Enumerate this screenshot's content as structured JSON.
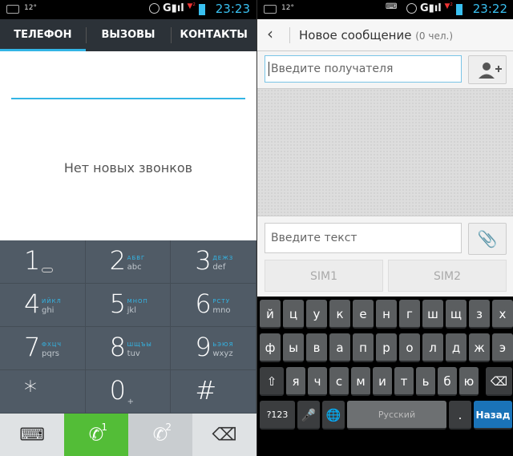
{
  "left": {
    "status": {
      "temp": "12°",
      "clock": "23:23"
    },
    "tabs": [
      "ТЕЛЕФОН",
      "ВЫЗОВЫ",
      "КОНТАКТЫ"
    ],
    "empty_text": "Нет новых звонков",
    "dialpad": [
      {
        "digit": "1",
        "letters": "",
        "latin": ""
      },
      {
        "digit": "2",
        "letters": "abc",
        "latin": "АБВГ"
      },
      {
        "digit": "3",
        "letters": "def",
        "latin": "ДЕЖЗ"
      },
      {
        "digit": "4",
        "letters": "ghi",
        "latin": "ИЙКЛ"
      },
      {
        "digit": "5",
        "letters": "jkl",
        "latin": "МНОП"
      },
      {
        "digit": "6",
        "letters": "mno",
        "latin": "РСТУ"
      },
      {
        "digit": "7",
        "letters": "pqrs",
        "latin": "ФХЦЧ"
      },
      {
        "digit": "8",
        "letters": "tuv",
        "latin": "ШЩЪЫ"
      },
      {
        "digit": "9",
        "letters": "wxyz",
        "latin": "ЬЭЮЯ"
      },
      {
        "digit": "*",
        "letters": "",
        "latin": ""
      },
      {
        "digit": "0",
        "letters": "+",
        "latin": ""
      },
      {
        "digit": "#",
        "letters": "",
        "latin": ""
      }
    ],
    "call_sim1": "1",
    "call_sim2": "2"
  },
  "right": {
    "status": {
      "temp": "12°",
      "clock": "23:22"
    },
    "title": "Новое сообщение",
    "count": "(0 чел.)",
    "recipient_placeholder": "Введите получателя",
    "text_placeholder": "Введите текст",
    "sim1": "SIM1",
    "sim2": "SIM2",
    "keyboard": {
      "row1": [
        "й",
        "ц",
        "у",
        "к",
        "е",
        "н",
        "г",
        "ш",
        "щ",
        "з",
        "х"
      ],
      "row2": [
        "ф",
        "ы",
        "в",
        "а",
        "п",
        "р",
        "о",
        "л",
        "д",
        "ж",
        "э"
      ],
      "row3": [
        "я",
        "ч",
        "с",
        "м",
        "и",
        "т",
        "ь",
        "б",
        "ю"
      ],
      "symbols": "?123",
      "space": "Русский",
      "dot": ".",
      "enter": "Назад"
    }
  }
}
